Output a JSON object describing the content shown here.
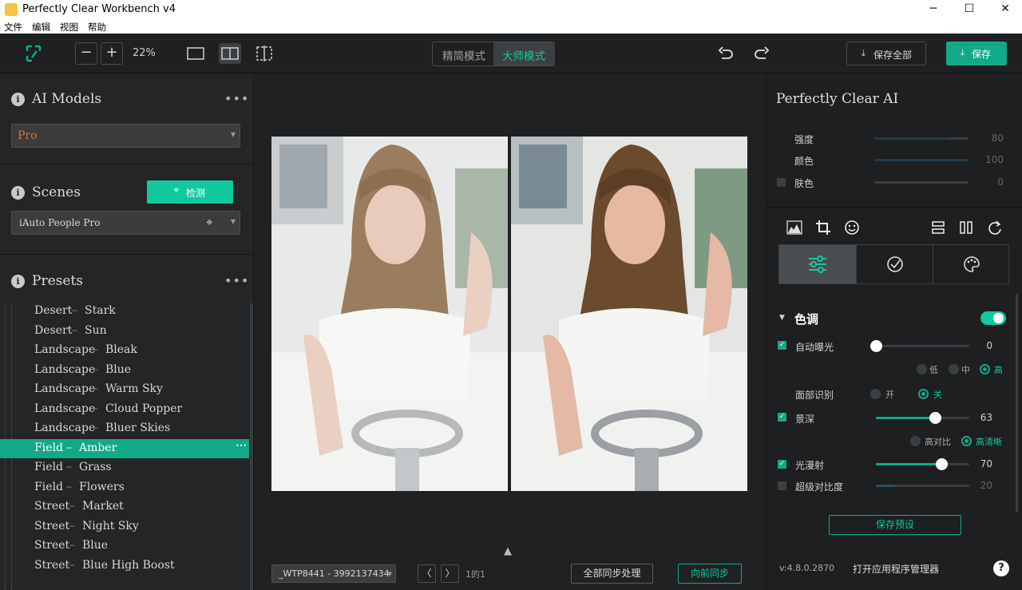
{
  "window": {
    "title": "Perfectly Clear Workbench v4",
    "minimize": "─",
    "maximize": "☐",
    "close": "✕"
  },
  "menu": [
    "文件",
    "编辑",
    "视图",
    "帮助"
  ],
  "toolbar": {
    "zoom_minus": "−",
    "zoom_plus": "+",
    "zoom_level": "22%",
    "mode_precise": "精简模式",
    "mode_master": "大师模式",
    "save_all": "保存全部",
    "save": "保存",
    "accent": "#12a989"
  },
  "left": {
    "ai_models": {
      "title": "AI Models",
      "dots": "•••",
      "selected": "Pro",
      "selected_color": "#e0703a"
    },
    "scenes": {
      "title": "Scenes",
      "detect_button": "检测",
      "selected": "iAuto People Pro"
    },
    "presets": {
      "title": "Presets",
      "dots": "•••",
      "items": [
        {
          "name": "Desert",
          "sep": "–",
          "sub": "Stark"
        },
        {
          "name": "Desert",
          "sep": "–",
          "sub": "Sun"
        },
        {
          "name": "Landscape",
          "sep": "–",
          "sub": "Bleak"
        },
        {
          "name": "Landscape",
          "sep": "–",
          "sub": "Blue"
        },
        {
          "name": "Landscape",
          "sep": "–",
          "sub": "Warm Sky"
        },
        {
          "name": "Landscape",
          "sep": "–",
          "sub": "Cloud Popper"
        },
        {
          "name": "Landscape",
          "sep": "–",
          "sub": "Bluer Skies"
        },
        {
          "name": "Field",
          "sep": "–",
          "sub": "Amber"
        },
        {
          "name": "Field",
          "sep": "–",
          "sub": "Grass"
        },
        {
          "name": "Field",
          "sep": "–",
          "sub": "Flowers"
        },
        {
          "name": "Street",
          "sep": "–",
          "sub": "Market"
        },
        {
          "name": "Street",
          "sep": "–",
          "sub": "Night Sky"
        },
        {
          "name": "Street",
          "sep": "–",
          "sub": "Blue"
        },
        {
          "name": "Street",
          "sep": "–",
          "sub": "Blue High Boost"
        }
      ],
      "selected_index": 7,
      "selected_more": "•••"
    }
  },
  "center": {
    "file_select": "_WTP8441 - 3992137434",
    "page_info": "1的1",
    "sync_all": "全部同步处理",
    "sync_prev": "向前同步",
    "expand": "▲"
  },
  "right": {
    "title": "Perfectly Clear AI",
    "strength": {
      "label": "强度",
      "value": "80",
      "level": 0.8
    },
    "color": {
      "label": "颜色",
      "value": "100",
      "level": 1.0
    },
    "skin": {
      "label": "肤色",
      "value": "0",
      "level": 0.0
    },
    "tone_title": "色调",
    "auto_exposure": {
      "label": "自动曝光",
      "value": "0",
      "level": 0.0,
      "checked": true
    },
    "exposure_levels": [
      "低",
      "中",
      "高"
    ],
    "face_detect": {
      "label": "面部识别",
      "on": "开",
      "off": "关"
    },
    "depth": {
      "label": "景深",
      "value": "63",
      "level": 0.63,
      "checked": true
    },
    "depth_modes": [
      "高对比",
      "高清晰"
    ],
    "diffuse": {
      "label": "光漫射",
      "value": "70",
      "level": 0.7,
      "checked": true
    },
    "super_contrast": {
      "label": "超级对比度",
      "value": "20",
      "level": 0.2,
      "checked": false
    },
    "save_preset": "保存预设",
    "version": "v:4.8.0.2870",
    "open_manager": "打开应用程序管理器",
    "help": "?"
  }
}
